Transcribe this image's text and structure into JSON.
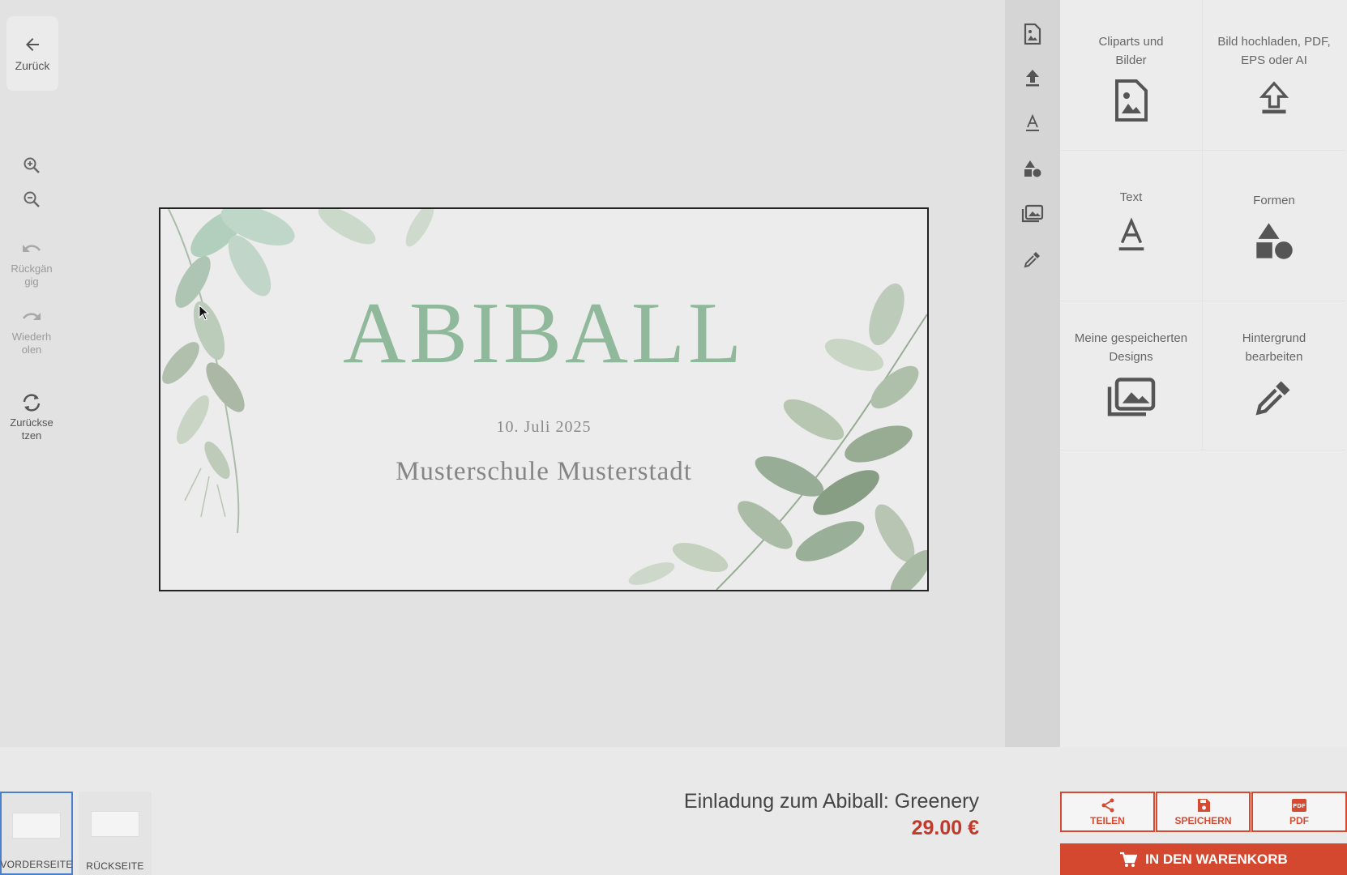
{
  "left_toolbar": {
    "back_label": "Zurück",
    "undo_label": "Rückgän\ngig",
    "redo_label": "Wiederh\nolen",
    "reset_label": "Zurückse\ntzen"
  },
  "canvas": {
    "title": "ABIBALL",
    "date": "10. Juli 2025",
    "school": "Musterschule Musterstadt"
  },
  "right_panel": {
    "tiles": [
      {
        "label": "Cliparts und\nBilder"
      },
      {
        "label": "Bild hochladen, PDF,\nEPS oder AI"
      },
      {
        "label": "Text"
      },
      {
        "label": "Formen"
      },
      {
        "label": "Meine gespeicherten\nDesigns"
      },
      {
        "label": "Hintergrund\nbearbeiten"
      }
    ]
  },
  "pages": [
    {
      "label": "VORDERSEITE"
    },
    {
      "label": "RÜCKSEITE"
    }
  ],
  "product": {
    "title": "Einladung zum Abiball: Greenery",
    "price": "29.00 €"
  },
  "actions": {
    "share": "TEILEN",
    "save": "SPEICHERN",
    "pdf": "PDF",
    "cart": "IN DEN WARENKORB"
  },
  "colors": {
    "accent": "#d3482f",
    "title_green": "#8fb99a"
  }
}
